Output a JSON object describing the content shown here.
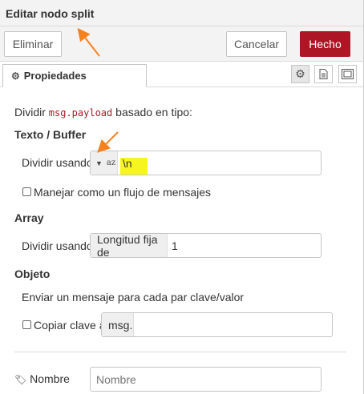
{
  "header": {
    "title": "Editar nodo split"
  },
  "toolbar": {
    "delete_label": "Eliminar",
    "cancel_label": "Cancelar",
    "done_label": "Hecho"
  },
  "tabs": {
    "properties_label": "Propiedades",
    "tools": [
      "gear-icon",
      "file-icon",
      "frame-icon"
    ]
  },
  "form": {
    "split_intro_prefix": "Dividir",
    "split_intro_code": "msg.payload",
    "split_intro_suffix": "basado en tipo:",
    "text_buffer_heading": "Texto / Buffer",
    "split_using_label": "Dividir usando",
    "split_using_type_glyph": "az",
    "split_using_value": "\\n",
    "stream_checkbox_label": "Manejar como un flujo de mensajes",
    "array_heading": "Array",
    "array_split_label": "Dividir usando",
    "array_split_prefix": "Longitud fija de",
    "array_split_value": "1",
    "object_heading": "Objeto",
    "object_description": "Enviar un mensaje para cada par clave/valor",
    "copy_key_label": "Copiar clave a",
    "copy_key_prefix": "msg.",
    "copy_key_value": "",
    "name_label": "Nombre",
    "name_placeholder": "Nombre",
    "name_value": ""
  },
  "colors": {
    "accent_red": "#ad1625",
    "annotation_arrow": "#f5821f",
    "highlight": "#f7f51f"
  }
}
